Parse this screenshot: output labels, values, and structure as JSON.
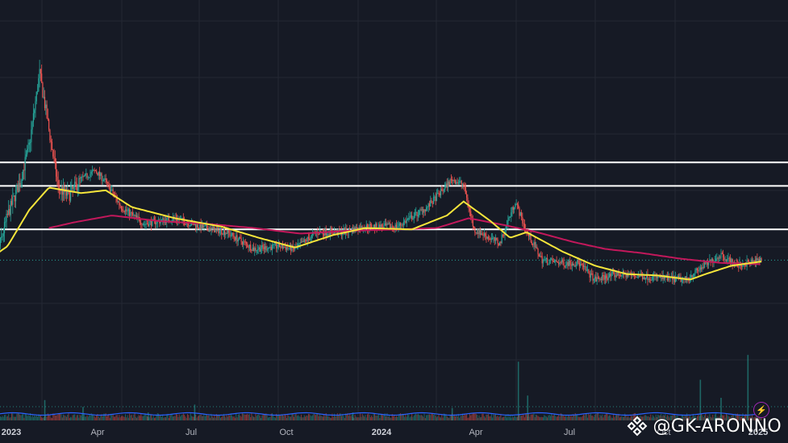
{
  "colors": {
    "background": "#161a25",
    "grid": "#242833",
    "up": "#26a69a",
    "down": "#ef5350",
    "ma_fast": "#f5e53b",
    "ma_slow": "#c2185b",
    "levels": "#ffffff",
    "volume_ma": "#2962ff"
  },
  "watermark": {
    "text": "@GK-ARONNO",
    "logo": "binance-diamond-logo"
  },
  "badge_icon": "lightning-icon",
  "chart_data": {
    "type": "candlestick",
    "x_ticks": [
      {
        "label": "2023",
        "major": true
      },
      {
        "label": "Apr",
        "major": false
      },
      {
        "label": "Jul",
        "major": false
      },
      {
        "label": "Oct",
        "major": false
      },
      {
        "label": "2024",
        "major": true
      },
      {
        "label": "Apr",
        "major": false
      },
      {
        "label": "Jul",
        "major": false
      },
      {
        "label": "Oct",
        "major": false
      },
      {
        "label": "2025",
        "major": true
      }
    ],
    "time_range": [
      "2023-01-01",
      "2025-01-18"
    ],
    "price_range_rel": [
      0,
      100
    ],
    "horizontal_levels": [
      69.0,
      60.6,
      45.0
    ],
    "price_anchors": [
      [
        "2023-01-01",
        34.0
      ],
      [
        "2023-01-10",
        36.0
      ],
      [
        "2023-01-20",
        50.0
      ],
      [
        "2023-02-01",
        62.0
      ],
      [
        "2023-02-10",
        75.0
      ],
      [
        "2023-02-20",
        101.0
      ],
      [
        "2023-02-28",
        83.0
      ],
      [
        "2023-03-10",
        60.0
      ],
      [
        "2023-03-20",
        57.0
      ],
      [
        "2023-04-01",
        63.0
      ],
      [
        "2023-04-15",
        66.0
      ],
      [
        "2023-04-25",
        62.0
      ],
      [
        "2023-05-10",
        53.0
      ],
      [
        "2023-06-01",
        47.0
      ],
      [
        "2023-07-01",
        49.0
      ],
      [
        "2023-07-25",
        46.0
      ],
      [
        "2023-08-20",
        44.0
      ],
      [
        "2023-09-15",
        38.0
      ],
      [
        "2023-10-10",
        39.0
      ],
      [
        "2023-10-25",
        38.0
      ],
      [
        "2023-11-15",
        44.0
      ],
      [
        "2023-12-10",
        44.0
      ],
      [
        "2024-01-01",
        46.0
      ],
      [
        "2024-02-01",
        46.0
      ],
      [
        "2024-03-01",
        53.0
      ],
      [
        "2024-03-25",
        63.0
      ],
      [
        "2024-04-05",
        61.0
      ],
      [
        "2024-04-15",
        45.0
      ],
      [
        "2024-05-10",
        40.0
      ],
      [
        "2024-05-25",
        55.0
      ],
      [
        "2024-06-05",
        44.0
      ],
      [
        "2024-06-20",
        34.0
      ],
      [
        "2024-07-10",
        33.0
      ],
      [
        "2024-07-25",
        33.0
      ],
      [
        "2024-08-10",
        27.0
      ],
      [
        "2024-09-01",
        29.0
      ],
      [
        "2024-10-01",
        28.0
      ],
      [
        "2024-11-05",
        27.0
      ],
      [
        "2024-11-20",
        31.0
      ],
      [
        "2024-12-10",
        36.0
      ],
      [
        "2024-12-25",
        32.0
      ],
      [
        "2025-01-18",
        34.0
      ]
    ],
    "ma_fast_anchors": [
      [
        "2023-01-01",
        34.0
      ],
      [
        "2023-01-20",
        39.0
      ],
      [
        "2023-02-10",
        52.0
      ],
      [
        "2023-03-01",
        60.0
      ],
      [
        "2023-04-01",
        58.0
      ],
      [
        "2023-04-25",
        59.0
      ],
      [
        "2023-05-20",
        53.0
      ],
      [
        "2023-07-01",
        49.0
      ],
      [
        "2023-08-15",
        46.0
      ],
      [
        "2023-09-20",
        42.0
      ],
      [
        "2023-10-25",
        38.5
      ],
      [
        "2023-12-01",
        43.0
      ],
      [
        "2024-01-01",
        45.5
      ],
      [
        "2024-02-15",
        45.0
      ],
      [
        "2024-03-20",
        50.0
      ],
      [
        "2024-04-05",
        55.0
      ],
      [
        "2024-05-01",
        48.0
      ],
      [
        "2024-05-20",
        42.0
      ],
      [
        "2024-06-05",
        44.0
      ],
      [
        "2024-07-10",
        37.0
      ],
      [
        "2024-08-10",
        32.0
      ],
      [
        "2024-09-10",
        29.0
      ],
      [
        "2024-10-10",
        28.5
      ],
      [
        "2024-11-10",
        27.0
      ],
      [
        "2024-11-25",
        29.0
      ],
      [
        "2024-12-20",
        32.0
      ],
      [
        "2025-01-18",
        33.5
      ]
    ],
    "ma_slow_anchors": [
      [
        "2023-03-01",
        45.5
      ],
      [
        "2023-03-25",
        47.5
      ],
      [
        "2023-05-01",
        50.0
      ],
      [
        "2023-06-15",
        48.0
      ],
      [
        "2023-08-01",
        47.0
      ],
      [
        "2023-09-15",
        45.5
      ],
      [
        "2023-10-30",
        43.5
      ],
      [
        "2023-12-15",
        44.5
      ],
      [
        "2024-02-01",
        45.0
      ],
      [
        "2024-03-10",
        45.5
      ],
      [
        "2024-04-10",
        49.0
      ],
      [
        "2024-05-15",
        46.5
      ],
      [
        "2024-06-15",
        44.0
      ],
      [
        "2024-07-20",
        40.5
      ],
      [
        "2024-08-20",
        38.0
      ],
      [
        "2024-09-25",
        36.5
      ],
      [
        "2024-11-01",
        34.5
      ],
      [
        "2024-12-10",
        33.0
      ],
      [
        "2025-01-18",
        32.5
      ]
    ],
    "volume_spikes": [
      [
        "2023-02-25",
        0.9
      ],
      [
        "2023-04-03",
        0.6
      ],
      [
        "2023-06-05",
        0.35
      ],
      [
        "2023-07-20",
        0.7
      ],
      [
        "2023-12-20",
        0.35
      ],
      [
        "2024-03-25",
        0.55
      ],
      [
        "2024-05-28",
        2.6
      ],
      [
        "2024-06-06",
        1.1
      ],
      [
        "2024-11-20",
        1.8
      ],
      [
        "2024-12-10",
        1.0
      ],
      [
        "2025-01-05",
        2.9
      ]
    ]
  }
}
